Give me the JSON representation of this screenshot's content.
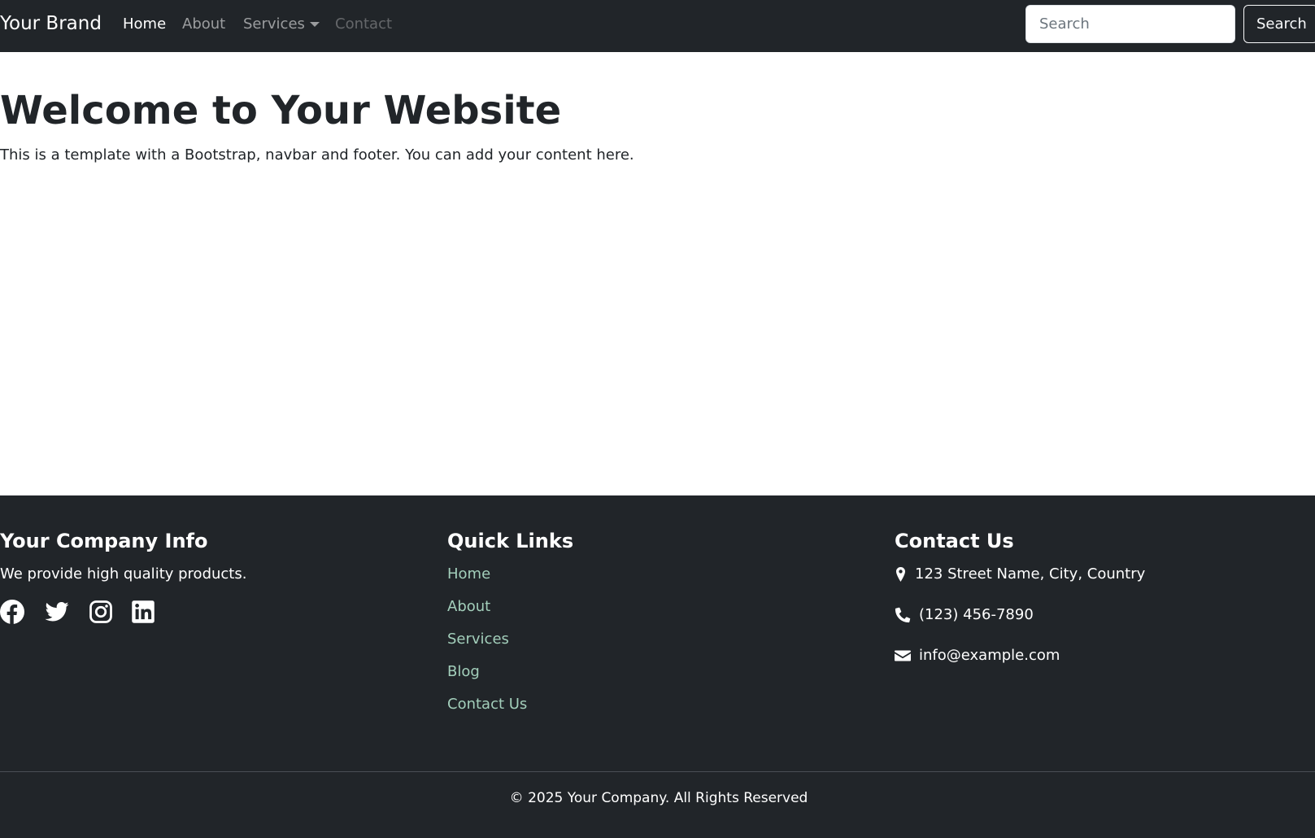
{
  "navbar": {
    "brand": "Your Brand",
    "links": [
      {
        "label": "Home",
        "state": "active"
      },
      {
        "label": "About",
        "state": "normal"
      },
      {
        "label": "Services",
        "state": "dropdown"
      },
      {
        "label": "Contact",
        "state": "disabled"
      }
    ],
    "search": {
      "placeholder": "Search",
      "value": "",
      "button_label": "Search"
    }
  },
  "main": {
    "title": "Welcome to Your Website",
    "text": "This is a template with a Bootstrap, navbar and footer. You can add your content here."
  },
  "footer": {
    "company": {
      "title": "Your Company Info",
      "description": "We provide high quality products.",
      "social_icons": [
        "facebook-icon",
        "twitter-icon",
        "instagram-icon",
        "linkedin-icon"
      ]
    },
    "quick_links": {
      "title": "Quick Links",
      "items": [
        "Home",
        "About",
        "Services",
        "Blog",
        "Contact Us"
      ]
    },
    "contact": {
      "title": "Contact Us",
      "address": "123 Street Name, City, Country",
      "phone": "(123) 456-7890",
      "email": "info@example.com",
      "icons": [
        "map-pin-icon",
        "phone-icon",
        "envelope-icon"
      ]
    },
    "copyright": "© 2025 Your Company. All Rights Reserved"
  },
  "colors": {
    "dark": "#212529",
    "link_green": "#a3cfbb",
    "white": "#ffffff"
  }
}
